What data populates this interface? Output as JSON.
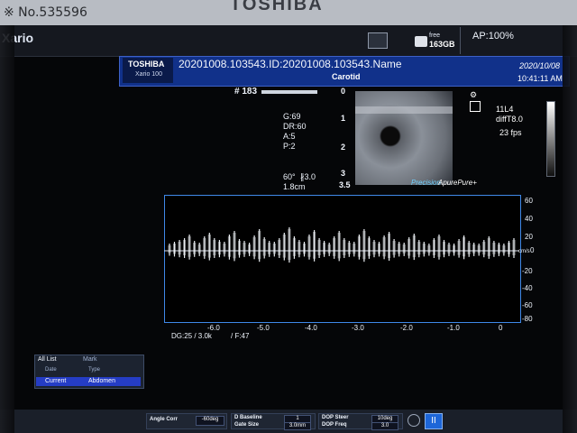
{
  "bezel": {
    "brand": "TOSHIBA",
    "photo_number": "※ No.535596"
  },
  "topbar": {
    "product_name": "Xario",
    "disk_free_label": "free",
    "disk_free_value": "163GB",
    "ap_level": "AP:100%"
  },
  "patient_header": {
    "brand_mini": "TOSHIBA",
    "model_mini": "Xario 100",
    "id_line": "20201008.103543.ID:20201008.103543.Name",
    "exam_type": "Carotid",
    "date": "2020/10/08",
    "time": "10:41:11 AM"
  },
  "imaging_params": {
    "frame_number": "# 183",
    "gain": "G:69",
    "dynamic_range": "DR:60",
    "a_value": "A:5",
    "p_value": "P:2",
    "angle_label": "60°",
    "sample_label": "∦3.0",
    "depth_cm": "1.8cm",
    "depth_marks": [
      "0",
      "1",
      "2",
      "3",
      "3.5"
    ],
    "probe": "11L4",
    "mode": "diffT8.0",
    "fps": "23 fps",
    "precision_label": "Precision",
    "apure_label": "ApurePure+"
  },
  "doppler": {
    "velocity_ticks": [
      "60",
      "40",
      "20",
      "0",
      "-20",
      "-40",
      "-60",
      "-80"
    ],
    "velocity_unit": "cm/s",
    "time_ticks": [
      "-6.0",
      "-5.0",
      "-4.0",
      "-3.0",
      "-2.0",
      "-1.0",
      "0"
    ],
    "params_left": "DG:25 / 3.0k",
    "params_right": "/ F:47",
    "spectrum_peaks": [
      6,
      8,
      10,
      12,
      16,
      9,
      7,
      14,
      18,
      12,
      10,
      8,
      16,
      20,
      11,
      9,
      7,
      15,
      22,
      13,
      9,
      8,
      12,
      18,
      24,
      14,
      10,
      8,
      16,
      21,
      12,
      9,
      7,
      14,
      20,
      12,
      9,
      8,
      16,
      22,
      14,
      10,
      8,
      15,
      19,
      11,
      8,
      7,
      13,
      17,
      10,
      8,
      6,
      12,
      16,
      10,
      7,
      6,
      11,
      15,
      9,
      7,
      6,
      10,
      14,
      9,
      7,
      6,
      9,
      12
    ]
  },
  "list_panel": {
    "tab_all": "All List",
    "tab_mark": "Mark",
    "header_date": "Date",
    "header_type": "Type",
    "row_date": "Current",
    "row_type": "Abdomen"
  },
  "bottombar": {
    "angle_corr_label": "Angle Corr",
    "angle_corr_value": "-60deg",
    "baseline_label": "D Baseline",
    "baseline_value": "1",
    "gate_size_label": "Gate Size",
    "gate_size_value": "3.0mm",
    "dop_steer_label": "DOP Steer",
    "dop_steer_value": "10deg",
    "dop_freq_label": "DOP Freq",
    "dop_freq_value": "3.0",
    "icon_b_label": "II"
  },
  "colors": {
    "header_blue": "#11318a",
    "doppler_border": "#3f88e8",
    "selected_row": "#253dc5"
  }
}
